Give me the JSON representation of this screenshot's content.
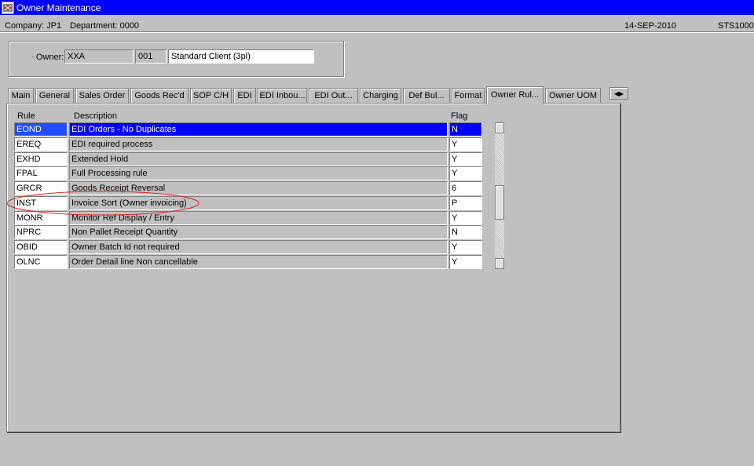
{
  "window": {
    "title": "Owner Maintenance"
  },
  "info": {
    "company": "Company:  JP1",
    "department": "Department:  0000",
    "date": "14-SEP-2010",
    "code": "STS1000"
  },
  "owner": {
    "label": "Owner:",
    "code": "XXA",
    "number": "001",
    "name": "Standard Client (3pl)"
  },
  "tabs": [
    {
      "label": "Main"
    },
    {
      "label": "General"
    },
    {
      "label": "Sales Order"
    },
    {
      "label": "Goods Rec'd"
    },
    {
      "label": "SOP C/H"
    },
    {
      "label": "EDI"
    },
    {
      "label": "EDI Inbou..."
    },
    {
      "label": "EDI Out..."
    },
    {
      "label": "Charging"
    },
    {
      "label": "Def Bul..."
    },
    {
      "label": "Format"
    },
    {
      "label": "Owner Rul..."
    },
    {
      "label": "Owner UOM"
    }
  ],
  "active_tab": "Owner Rul...",
  "tab_scroll_icon": "left-right-arrows-icon",
  "grid": {
    "headers": {
      "rule": "Rule",
      "description": "Description",
      "flag": "Flag"
    },
    "rows": [
      {
        "rule": "EOND",
        "description": "EDI Orders - No Duplicates",
        "flag": "N"
      },
      {
        "rule": "EREQ",
        "description": "EDI required process",
        "flag": "Y"
      },
      {
        "rule": "EXHD",
        "description": "Extended Hold",
        "flag": "Y"
      },
      {
        "rule": "FPAL",
        "description": "Full Processing rule",
        "flag": "Y"
      },
      {
        "rule": "GRCR",
        "description": "Goods Receipt Reversal",
        "flag": "6"
      },
      {
        "rule": "INST",
        "description": "Invoice Sort (Owner invoicing)",
        "flag": "P"
      },
      {
        "rule": "MONR",
        "description": "Monitor Ref Display / Entry",
        "flag": "Y"
      },
      {
        "rule": "NPRC",
        "description": "Non Pallet Receipt Quantity",
        "flag": "N"
      },
      {
        "rule": "OBID",
        "description": "Owner Batch Id not required",
        "flag": "Y"
      },
      {
        "rule": "OLNC",
        "description": "Order Detail line Non cancellable",
        "flag": "Y"
      }
    ],
    "selected_row": "EOND",
    "highlighted_row": "INST"
  },
  "colors": {
    "titlebar": "#0000ff",
    "background": "#c0c0c0",
    "selection": "#0000ff",
    "annotation": "#e02020"
  }
}
